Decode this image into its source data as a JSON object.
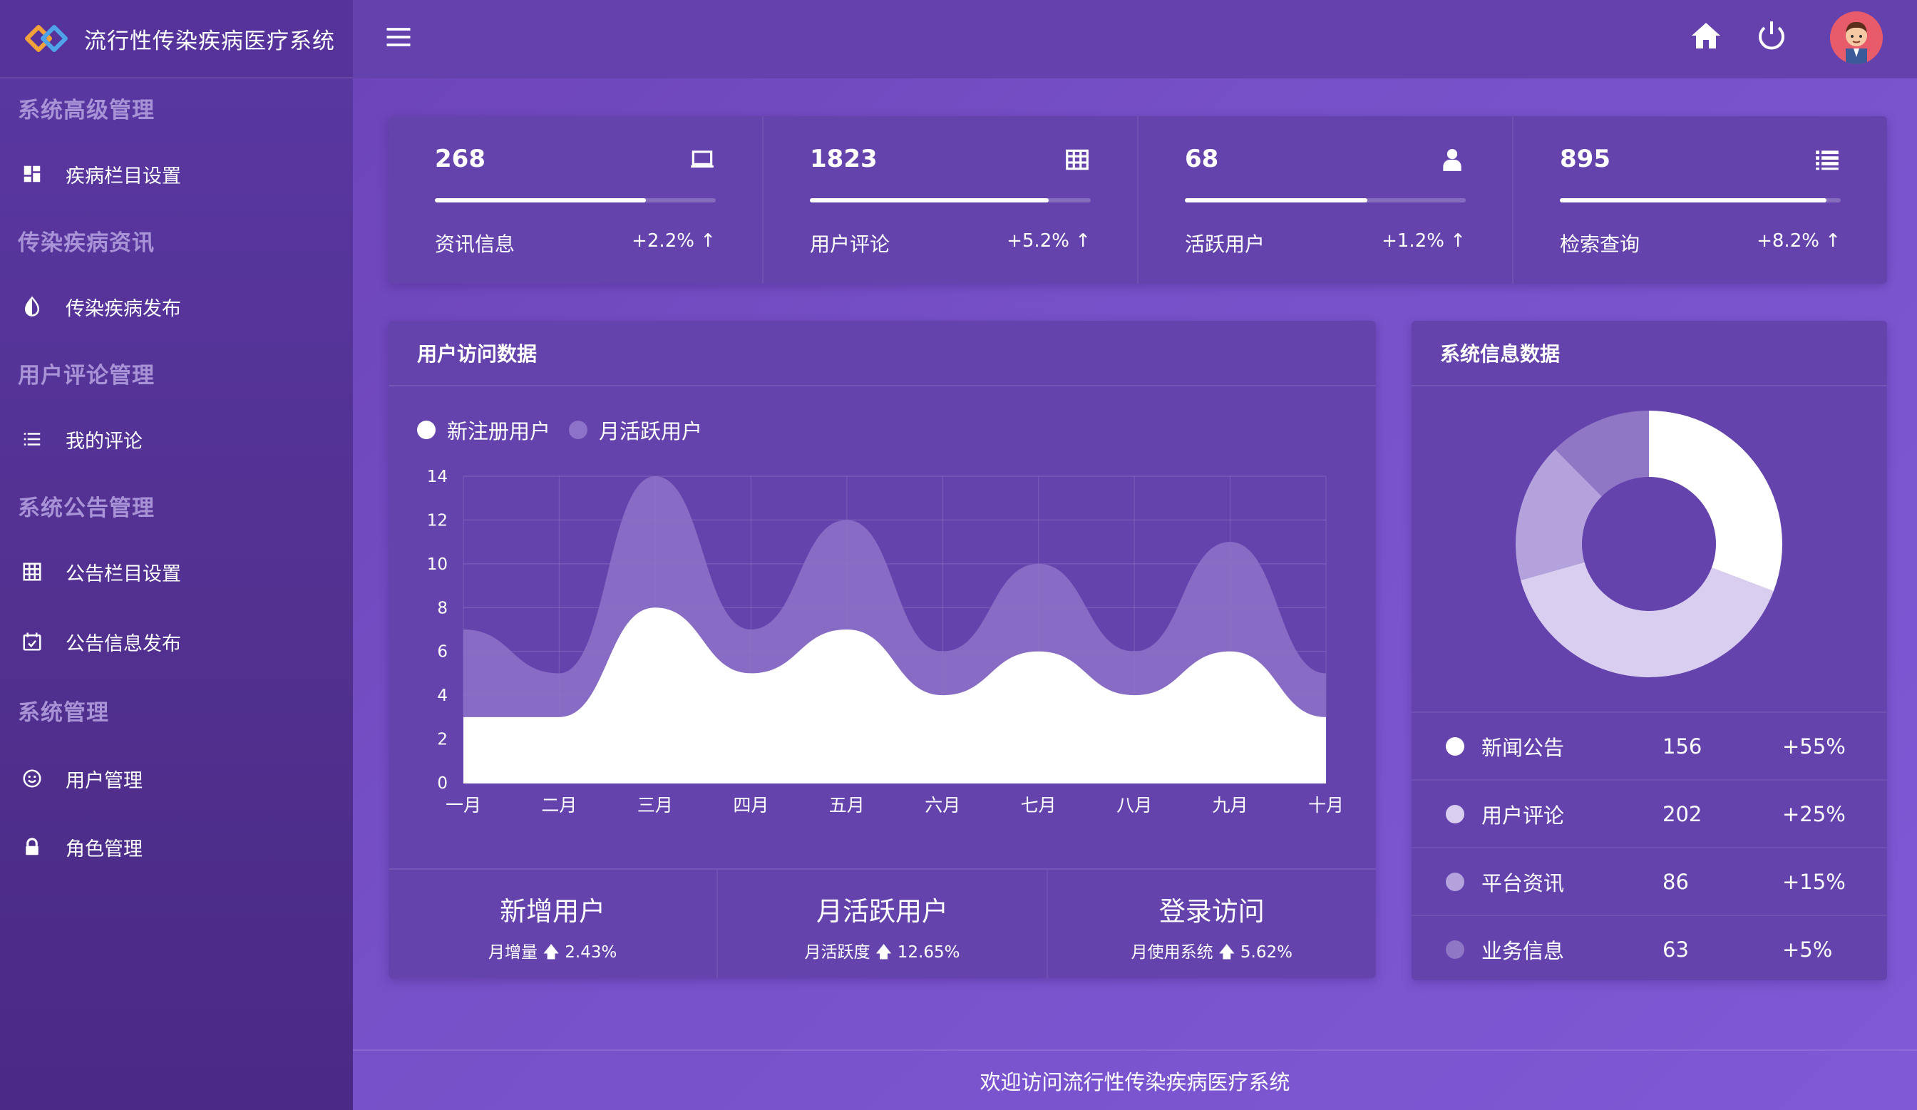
{
  "app": {
    "title": "流行性传染疾病医疗系统"
  },
  "sidebar": {
    "sections": [
      {
        "title": "系统高级管理",
        "items": [
          {
            "label": "疾病栏目设置",
            "icon": "dashboard-icon"
          }
        ]
      },
      {
        "title": "传染疾病资讯",
        "items": [
          {
            "label": "传染疾病发布",
            "icon": "contrast-icon"
          }
        ]
      },
      {
        "title": "用户评论管理",
        "items": [
          {
            "label": "我的评论",
            "icon": "list-icon"
          }
        ]
      },
      {
        "title": "系统公告管理",
        "items": [
          {
            "label": "公告栏目设置",
            "icon": "grid-icon"
          },
          {
            "label": "公告信息发布",
            "icon": "calendar-check-icon"
          }
        ]
      },
      {
        "title": "系统管理",
        "items": [
          {
            "label": "用户管理",
            "icon": "smile-icon"
          },
          {
            "label": "角色管理",
            "icon": "lock-icon"
          }
        ]
      }
    ]
  },
  "topbar": {
    "icons": [
      "menu-icon",
      "home-icon",
      "power-icon",
      "avatar"
    ]
  },
  "stats": [
    {
      "value": "268",
      "label": "资讯信息",
      "change": "+2.2% ↑",
      "progress": 0.75,
      "icon": "laptop-icon"
    },
    {
      "value": "1823",
      "label": "用户评论",
      "change": "+5.2% ↑",
      "progress": 0.85,
      "icon": "table-icon"
    },
    {
      "value": "68",
      "label": "活跃用户",
      "change": "+1.2% ↑",
      "progress": 0.65,
      "icon": "user-icon"
    },
    {
      "value": "895",
      "label": "检索查询",
      "change": "+8.2% ↑",
      "progress": 0.95,
      "icon": "list-icon"
    }
  ],
  "visit_panel": {
    "title": "用户访问数据",
    "legend": [
      {
        "name": "新注册用户",
        "color": "#ffffff"
      },
      {
        "name": "月活跃用户",
        "color": "#8d72c9"
      }
    ],
    "bottom": [
      {
        "title": "新增用户",
        "sub": "月增量 🡅 2.43%"
      },
      {
        "title": "月活跃用户",
        "sub": "月活跃度 🡅 12.65%"
      },
      {
        "title": "登录访问",
        "sub": "月使用系统 🡅 5.62%"
      }
    ]
  },
  "info_panel": {
    "title": "系统信息数据",
    "rows": [
      {
        "name": "新闻公告",
        "count": "156",
        "pct": "+55%",
        "color": "#ffffff"
      },
      {
        "name": "用户评论",
        "count": "202",
        "pct": "+25%",
        "color": "#d9cdf0"
      },
      {
        "name": "平台资讯",
        "count": "86",
        "pct": "+15%",
        "color": "#b3a2dc"
      },
      {
        "name": "业务信息",
        "count": "63",
        "pct": "+5%",
        "color": "#8f77c6"
      }
    ]
  },
  "footer": {
    "text": "欢迎访问流行性传染疾病医疗系统"
  },
  "chart_data": [
    {
      "type": "area",
      "categories": [
        "一月",
        "二月",
        "三月",
        "四月",
        "五月",
        "六月",
        "七月",
        "八月",
        "九月",
        "十月"
      ],
      "series": [
        {
          "name": "新注册用户",
          "values": [
            3,
            3,
            8,
            5,
            7,
            4,
            6,
            4,
            6,
            3
          ],
          "color": "#ffffff"
        },
        {
          "name": "月活跃用户",
          "values": [
            7,
            5,
            14,
            7,
            12,
            6,
            10,
            6,
            11,
            5
          ],
          "color": "#8d72c9"
        }
      ],
      "ylim": [
        0,
        14
      ],
      "yticks": [
        0,
        2,
        4,
        6,
        8,
        10,
        12,
        14
      ],
      "grid": true,
      "legend": "top-left",
      "title": "",
      "xlabel": "",
      "ylabel": ""
    },
    {
      "type": "pie",
      "donut": true,
      "labels": [
        "新闻公告",
        "用户评论",
        "平台资讯",
        "业务信息"
      ],
      "values": [
        156,
        202,
        86,
        63
      ],
      "colors": [
        "#ffffff",
        "#d9cdf0",
        "#b3a2dc",
        "#8f77c6"
      ],
      "title": ""
    }
  ]
}
